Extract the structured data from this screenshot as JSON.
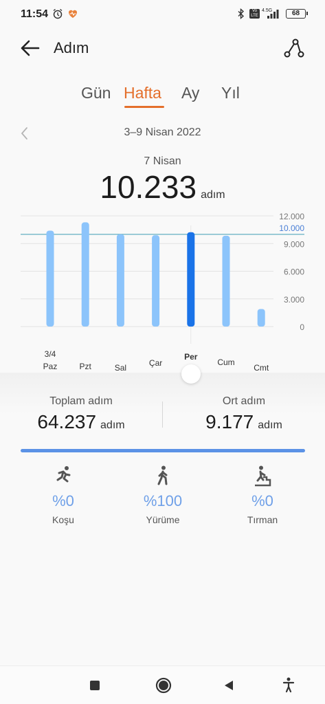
{
  "status_bar": {
    "time": "11:54",
    "network": "4.5G",
    "volte": "Vo LTE",
    "battery": "68"
  },
  "header": {
    "title": "Adım"
  },
  "tabs": [
    {
      "label": "Gün",
      "active": false
    },
    {
      "label": "Hafta",
      "active": true
    },
    {
      "label": "Ay",
      "active": false
    },
    {
      "label": "Yıl",
      "active": false
    }
  ],
  "date_range": "3–9 Nisan 2022",
  "selected": {
    "date": "7 Nisan",
    "value": "10.233",
    "unit": "adım"
  },
  "chart_data": {
    "type": "bar",
    "categories": [
      "Paz",
      "Pzt",
      "Sal",
      "Çar",
      "Per",
      "Cum",
      "Cmt"
    ],
    "date_tag": "3/4",
    "values": [
      10400,
      11300,
      10000,
      9900,
      10233,
      9850,
      1900
    ],
    "selected_index": 4,
    "goal": 10000,
    "goal_label": "10.000",
    "ylim": [
      0,
      12000
    ],
    "y_ticks": [
      {
        "value": 0,
        "label": "0"
      },
      {
        "value": 3000,
        "label": "3.000"
      },
      {
        "value": 6000,
        "label": "6.000"
      },
      {
        "value": 9000,
        "label": "9.000"
      },
      {
        "value": 12000,
        "label": "12.000"
      }
    ],
    "colors": {
      "bar": "#8cc4fb",
      "selected": "#1a73e8",
      "goal": "#3d9db3"
    }
  },
  "stats": {
    "total_label": "Toplam adım",
    "total_value": "64.237",
    "average_label": "Ort adım",
    "average_value": "9.177",
    "unit": "adım"
  },
  "activities": [
    {
      "icon": "running-icon",
      "percent": "%0",
      "label": "Koşu"
    },
    {
      "icon": "walking-icon",
      "percent": "%100",
      "label": "Yürüme"
    },
    {
      "icon": "climbing-icon",
      "percent": "%0",
      "label": "Tırman"
    }
  ],
  "colors": {
    "accent": "#e46f2b",
    "blue": "#5b92e6"
  }
}
